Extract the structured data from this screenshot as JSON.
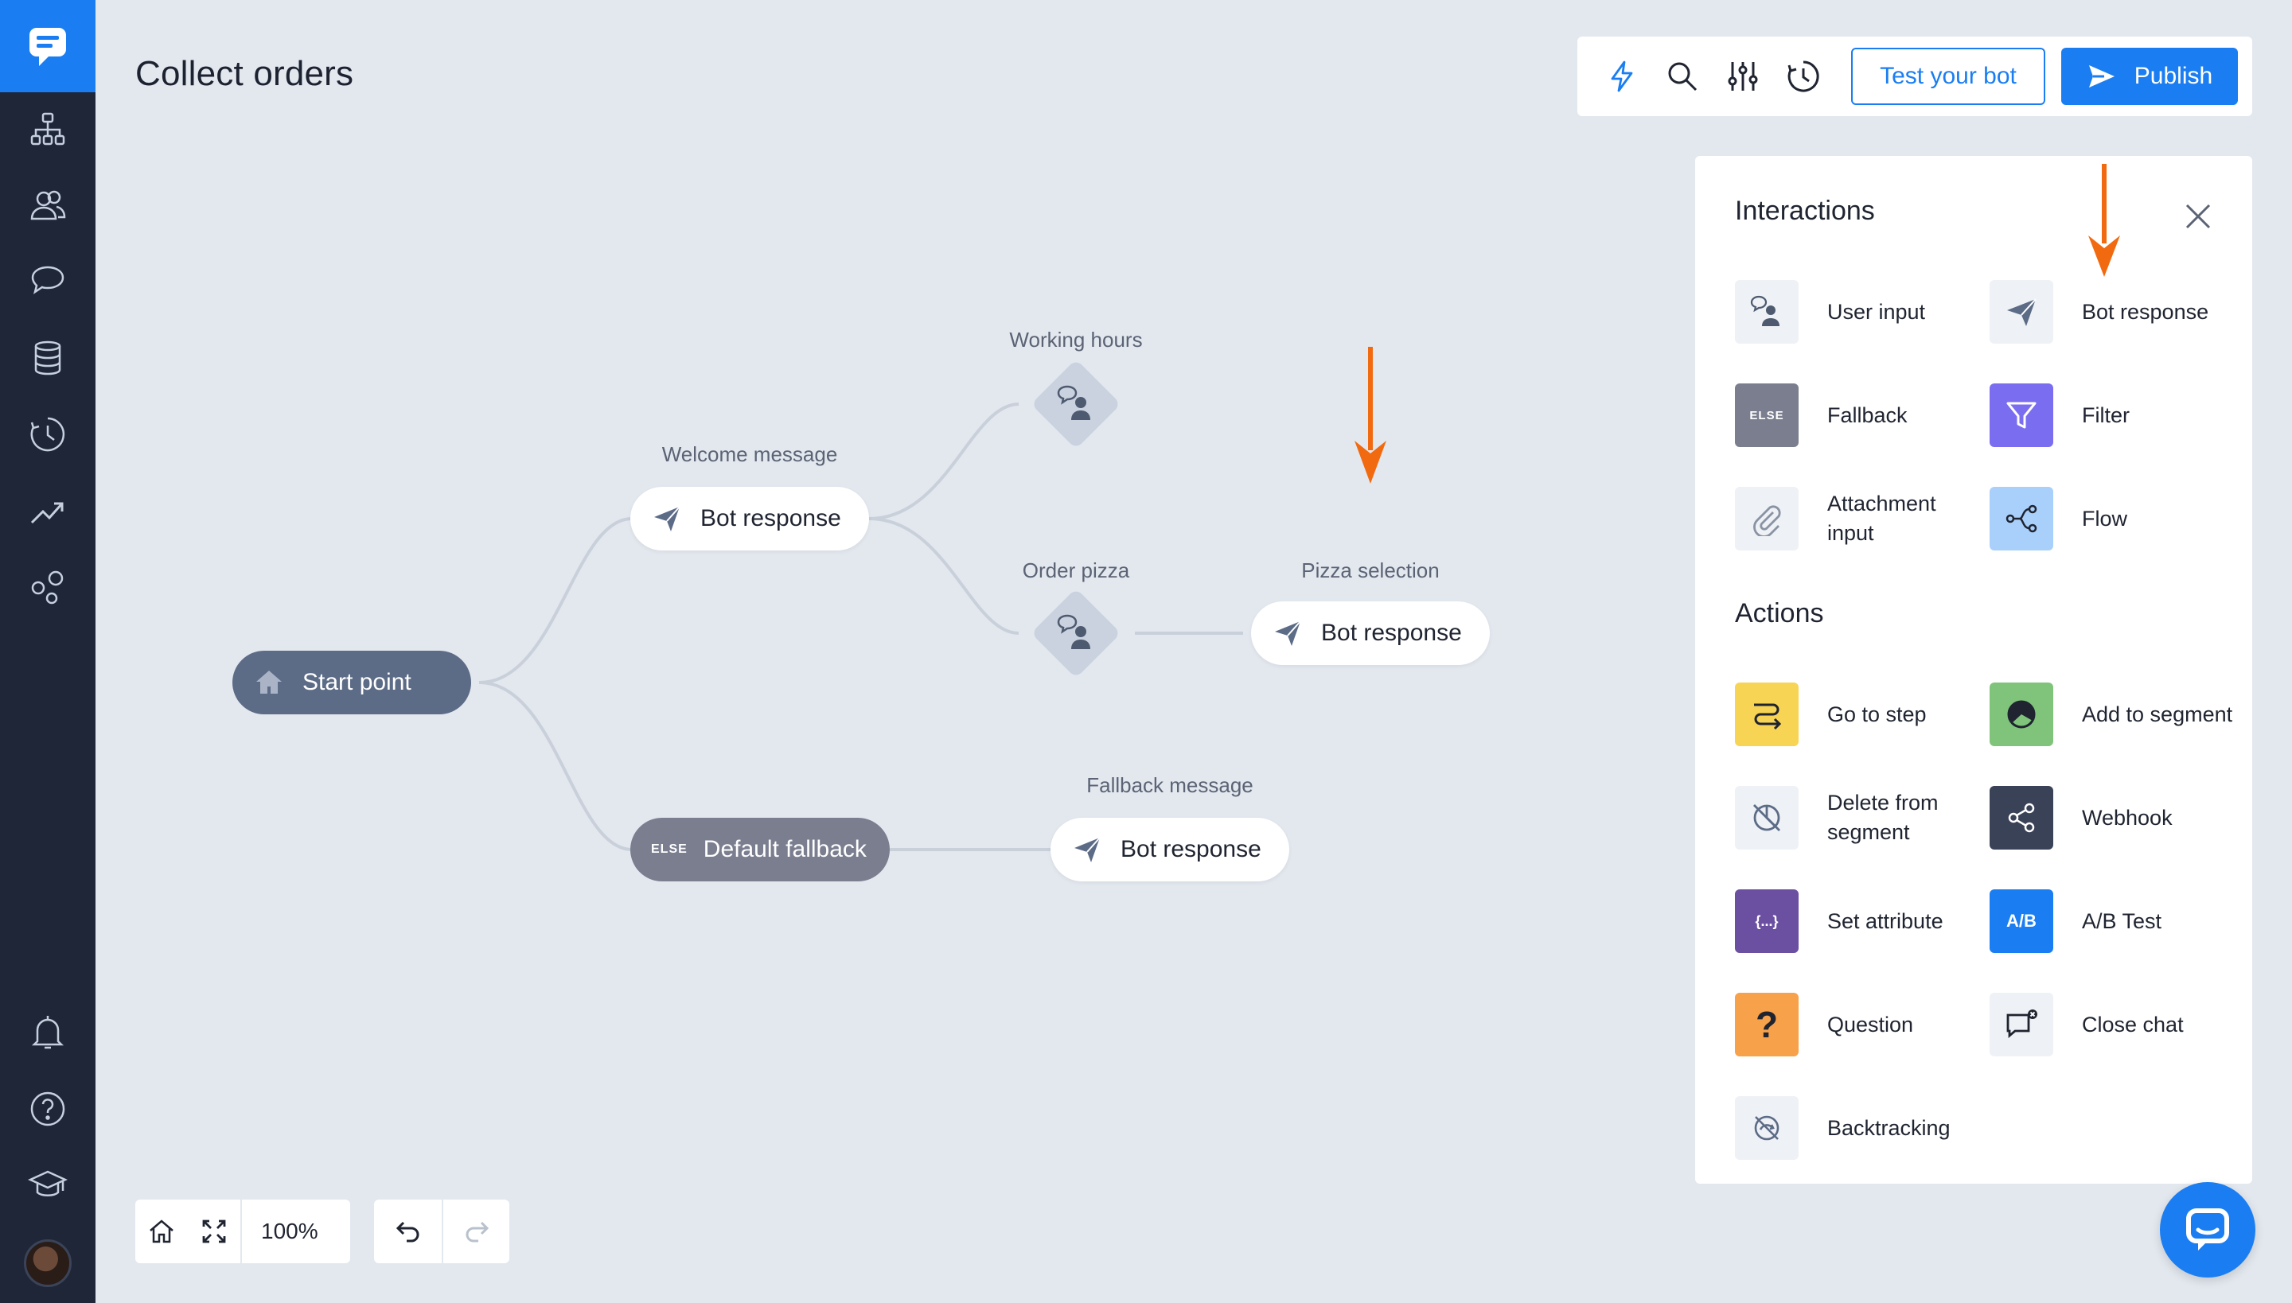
{
  "app": {
    "page_title": "Collect orders",
    "accent_color": "#1a7ef2"
  },
  "sidebar": {
    "items": [
      {
        "name": "stories-icon"
      },
      {
        "name": "audience-icon"
      },
      {
        "name": "chats-icon"
      },
      {
        "name": "data-icon"
      },
      {
        "name": "history-icon"
      },
      {
        "name": "reports-icon"
      },
      {
        "name": "integrations-icon"
      },
      {
        "name": "notifications-icon"
      },
      {
        "name": "help-icon"
      },
      {
        "name": "academy-icon"
      }
    ]
  },
  "toolbar": {
    "test_label": "Test your bot",
    "publish_label": "Publish",
    "icons": [
      "lightning-icon",
      "search-icon",
      "settings-sliders-icon",
      "history-icon"
    ]
  },
  "canvas": {
    "start_node": {
      "label": "Start point"
    },
    "welcome": {
      "title": "Welcome message",
      "label": "Bot response"
    },
    "working_hours": {
      "title": "Working hours"
    },
    "order_pizza": {
      "title": "Order pizza"
    },
    "pizza_selection": {
      "title": "Pizza selection",
      "label": "Bot response"
    },
    "default_fallback": {
      "tag": "ELSE",
      "label": "Default fallback"
    },
    "fallback_message": {
      "title": "Fallback message",
      "label": "Bot response"
    }
  },
  "controls": {
    "zoom": "100%"
  },
  "panel": {
    "interactions_title": "Interactions",
    "actions_title": "Actions",
    "interactions": [
      {
        "label": "User input",
        "color": "#eef1f5",
        "icon": "user-input-icon"
      },
      {
        "label": "Bot response",
        "color": "#eef1f5",
        "icon": "send-icon"
      },
      {
        "label": "Fallback",
        "color": "#7a7e8f",
        "icon": "else-icon",
        "tag": "ELSE"
      },
      {
        "label": "Filter",
        "color": "#7a6df0",
        "icon": "filter-icon"
      },
      {
        "label": "Attachment input",
        "color": "#eef1f5",
        "icon": "paperclip-icon"
      },
      {
        "label": "Flow",
        "color": "#a9d0fb",
        "icon": "flow-icon"
      }
    ],
    "actions": [
      {
        "label": "Go to step",
        "color": "#f7d454",
        "icon": "goto-icon"
      },
      {
        "label": "Add to segment",
        "color": "#7fc47a",
        "icon": "segment-icon"
      },
      {
        "label": "Delete from segment",
        "color": "#eef1f5",
        "icon": "delete-segment-icon"
      },
      {
        "label": "Webhook",
        "color": "#3a4258",
        "icon": "webhook-icon"
      },
      {
        "label": "Set attribute",
        "color": "#6b4fa0",
        "icon": "attribute-icon",
        "tag": "{...}"
      },
      {
        "label": "A/B Test",
        "color": "#1a7ef2",
        "icon": "ab-test-icon",
        "tag": "A/B"
      },
      {
        "label": "Question",
        "color": "#f7a14a",
        "icon": "question-icon",
        "tag": "?"
      },
      {
        "label": "Close chat",
        "color": "#eef1f5",
        "icon": "close-chat-icon"
      },
      {
        "label": "Backtracking",
        "color": "#eef1f5",
        "icon": "backtracking-icon"
      }
    ]
  }
}
